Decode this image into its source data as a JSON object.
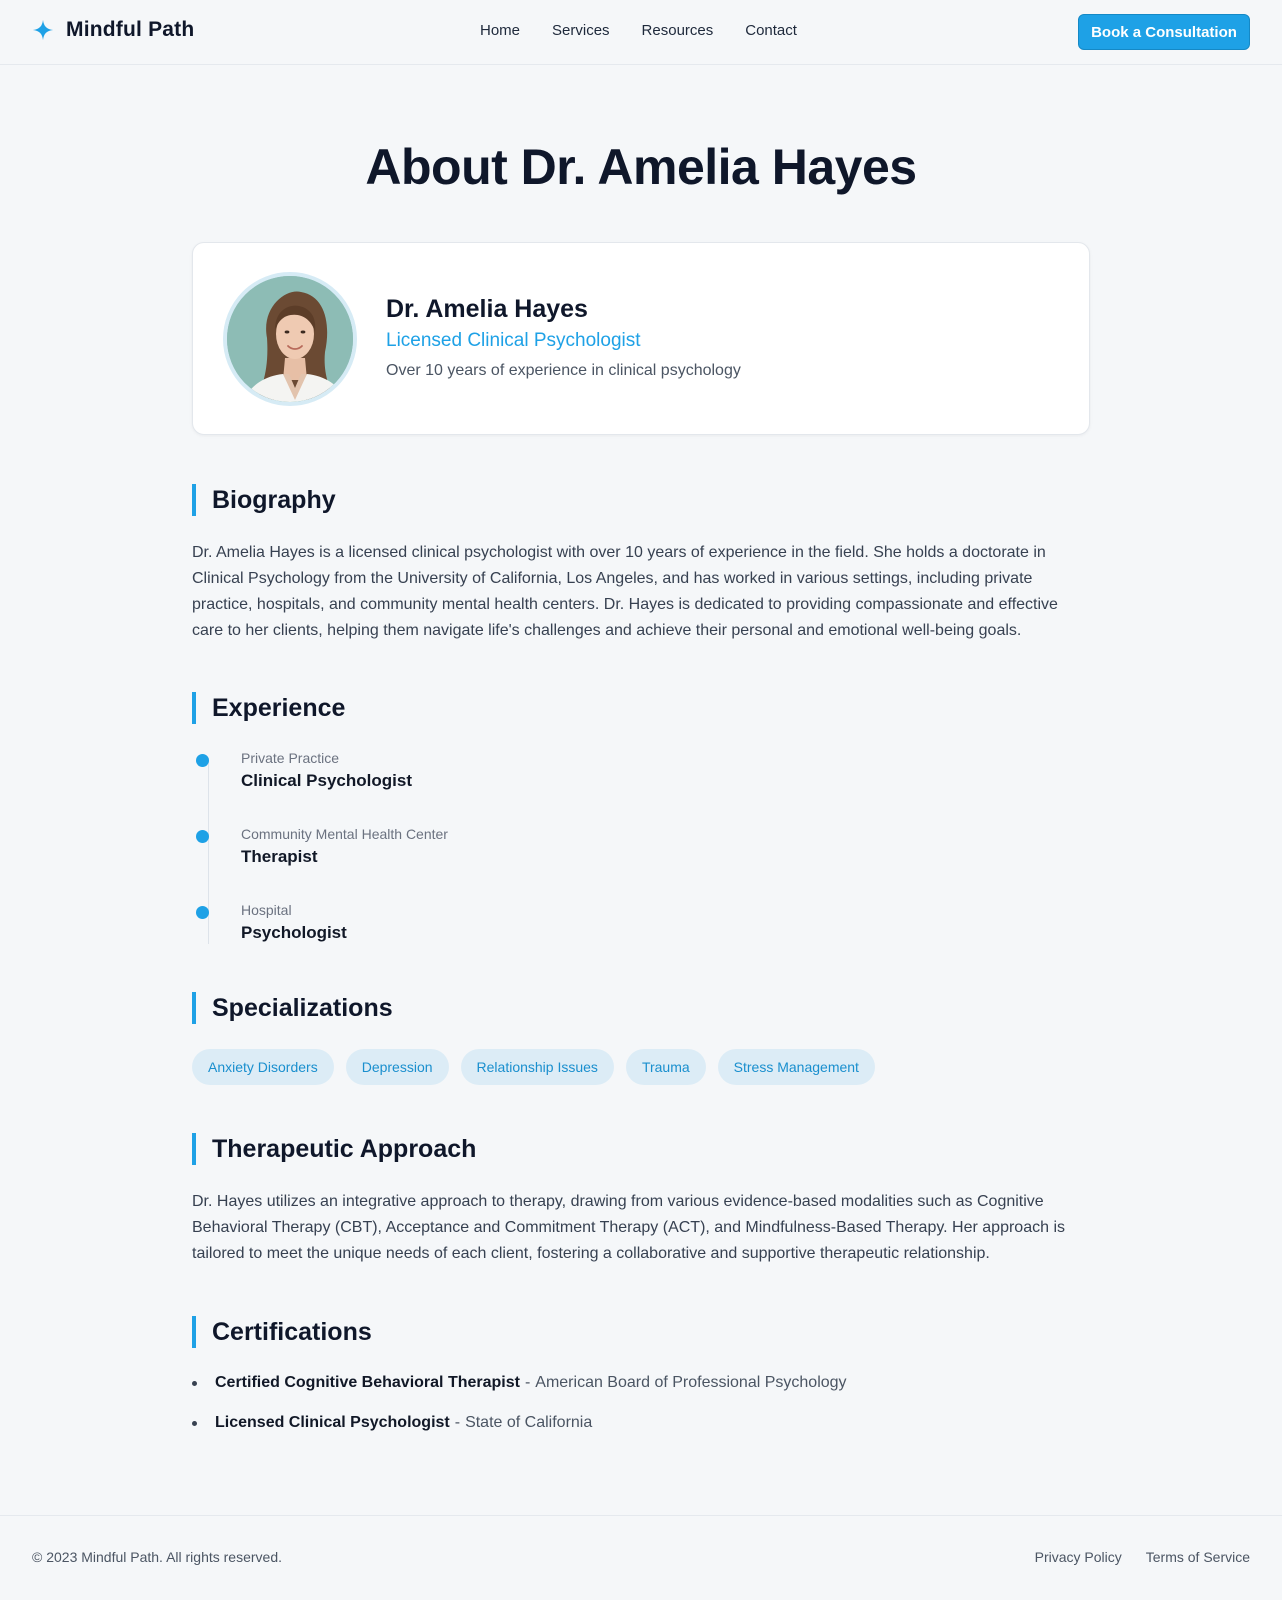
{
  "header": {
    "brand": "Mindful Path",
    "brand_icon": "sparkle-icon",
    "nav": [
      "Home",
      "Services",
      "Resources",
      "Contact"
    ],
    "cta": "Book a Consultation"
  },
  "page_title": "About Dr. Amelia Hayes",
  "profile": {
    "name": "Dr. Amelia Hayes",
    "role": "Licensed Clinical Psychologist",
    "experience": "Over 10 years of experience in clinical psychology"
  },
  "biography": {
    "heading": "Biography",
    "text": "Dr. Amelia Hayes is a licensed clinical psychologist with over 10 years of experience in the field. She holds a doctorate in Clinical Psychology from the University of California, Los Angeles, and has worked in various settings, including private practice, hospitals, and community mental health centers. Dr. Hayes is dedicated to providing compassionate and effective care to her clients, helping them navigate life's challenges and achieve their personal and emotional well-being goals."
  },
  "experience": {
    "heading": "Experience",
    "items": [
      {
        "org": "Private Practice",
        "role": "Clinical Psychologist"
      },
      {
        "org": "Community Mental Health Center",
        "role": "Therapist"
      },
      {
        "org": "Hospital",
        "role": "Psychologist"
      }
    ]
  },
  "specializations": {
    "heading": "Specializations",
    "tags": [
      "Anxiety Disorders",
      "Depression",
      "Relationship Issues",
      "Trauma",
      "Stress Management"
    ]
  },
  "approach": {
    "heading": "Therapeutic Approach",
    "text": "Dr. Hayes utilizes an integrative approach to therapy, drawing from various evidence-based modalities such as Cognitive Behavioral Therapy (CBT), Acceptance and Commitment Therapy (ACT), and Mindfulness-Based Therapy. Her approach is tailored to meet the unique needs of each client, fostering a collaborative and supportive therapeutic relationship."
  },
  "certifications": {
    "heading": "Certifications",
    "items": [
      {
        "name": "Certified Cognitive Behavioral Therapist",
        "issuer": "American Board of Professional Psychology"
      },
      {
        "name": "Licensed Clinical Psychologist",
        "issuer": "State of California"
      }
    ],
    "separator": "-"
  },
  "footer": {
    "copyright": "© 2023 Mindful Path. All rights reserved.",
    "links": [
      "Privacy Policy",
      "Terms of Service"
    ]
  },
  "colors": {
    "accent": "#1ea1e6",
    "tag_bg": "#dcecf6",
    "text_dark": "#0f172a",
    "background": "#f5f7f9"
  }
}
